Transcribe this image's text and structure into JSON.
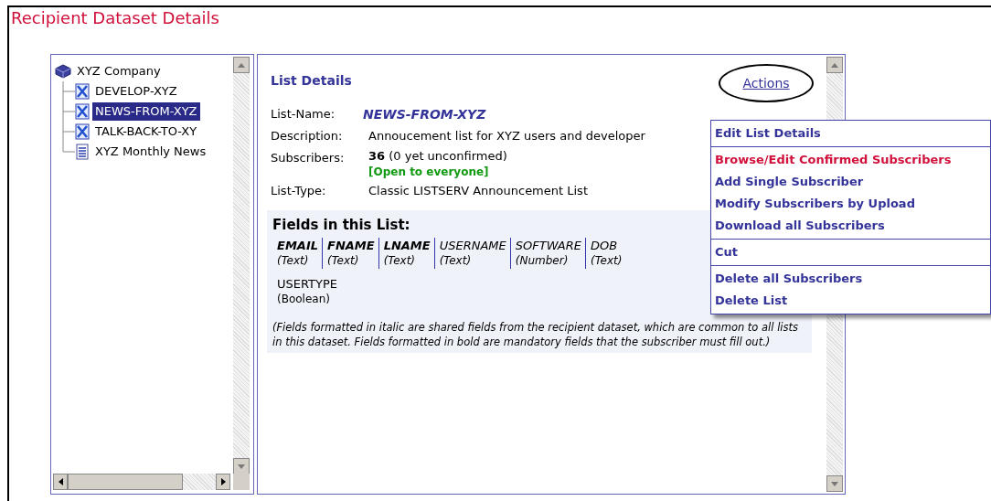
{
  "title": "Recipient Dataset Details",
  "tree": [
    {
      "label": "XYZ Company",
      "kind": "company",
      "selected": false,
      "children": [
        {
          "label": "DEVELOP-XYZ",
          "kind": "list",
          "selected": false
        },
        {
          "label": "NEWS-FROM-XYZ",
          "kind": "list",
          "selected": true
        },
        {
          "label": "TALK-BACK-TO-XY",
          "kind": "list",
          "selected": false
        },
        {
          "label": "XYZ Monthly News",
          "kind": "newsletter",
          "selected": false
        }
      ]
    }
  ],
  "details": {
    "heading": "List Details",
    "actions_link": "Actions",
    "rows": [
      {
        "label": "List-Name:",
        "kind": "name",
        "value": "NEWS-FROM-XYZ"
      },
      {
        "label": "Description:",
        "kind": "text",
        "value": "Annoucement list for XYZ users and developer"
      },
      {
        "label": "Subscribers:",
        "kind": "subscribers",
        "value": "**36** (0 yet unconfirmed)",
        "note": "[Open to everyone]"
      },
      {
        "label": "List-Type:",
        "kind": "text",
        "value": "Classic LISTSERV Announcement List"
      }
    ],
    "fields_heading": "Fields in this List:",
    "field_rows": [
      [
        {
          "name": "EMAIL",
          "type": "(Text)",
          "bold": true,
          "italic": true
        },
        {
          "name": "FNAME",
          "type": "(Text)",
          "bold": true,
          "italic": true
        },
        {
          "name": "LNAME",
          "type": "(Text)",
          "bold": true,
          "italic": true
        },
        {
          "name": "USERNAME",
          "type": "(Text)",
          "bold": false,
          "italic": true
        },
        {
          "name": "SOFTWARE",
          "type": "(Number)",
          "bold": false,
          "italic": true
        },
        {
          "name": "DOB",
          "type": "(Text)",
          "bold": false,
          "italic": true
        }
      ],
      [
        {
          "name": "USERTYPE",
          "type": "(Boolean)",
          "bold": false,
          "italic": false
        }
      ]
    ],
    "fields_note": "(Fields formatted in italic are shared fields from the recipient dataset, which are common to all lists in this dataset. Fields formatted in bold are mandatory fields that the subscriber must fill out.)"
  },
  "menu": [
    [
      {
        "label": "Edit List Details",
        "highlighted": false
      }
    ],
    [
      {
        "label": "Browse/Edit Confirmed Subscribers",
        "highlighted": true
      },
      {
        "label": "Add Single Subscriber",
        "highlighted": false
      },
      {
        "label": "Modify Subscribers by Upload",
        "highlighted": false
      },
      {
        "label": "Download all Subscribers",
        "highlighted": false
      }
    ],
    [
      {
        "label": "Cut",
        "highlighted": false
      }
    ],
    [
      {
        "label": "Delete all Subscribers",
        "highlighted": false
      },
      {
        "label": "Delete List",
        "highlighted": false
      }
    ]
  ]
}
